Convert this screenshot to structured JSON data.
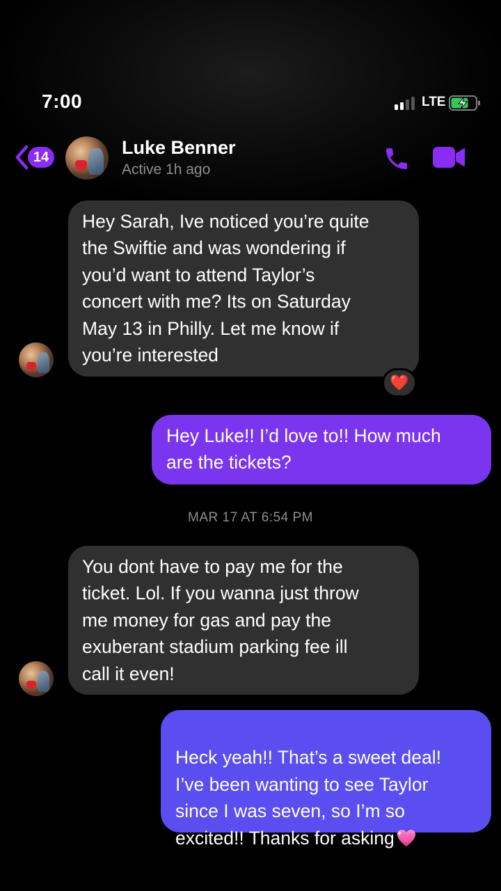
{
  "status_bar": {
    "time": "7:00",
    "network": "LTE"
  },
  "header": {
    "back_badge": "14",
    "contact_name": "Luke Benner",
    "contact_status": "Active 1h ago"
  },
  "icons": {
    "back": "chevron-left-icon",
    "call": "phone-icon",
    "video": "video-camera-icon",
    "reaction": "red-heart-emoji",
    "sparkle_heart": "sparkling-heart-emoji"
  },
  "colors": {
    "accent": "#8b2cf5",
    "outgoing_1": "#7b35ef",
    "outgoing_2": "#5a4ef0",
    "incoming": "#303030",
    "background": "#000000"
  },
  "messages": [
    {
      "sender": "Luke Benner",
      "direction": "incoming",
      "text": "Hey Sarah, Ive noticed you’re quite\nthe Swiftie and was wondering if\nyou’d want to attend Taylor’s\nconcert with me?  Its on Saturday\nMay 13 in Philly.  Let me know if\nyou’re interested",
      "reaction": "❤️"
    },
    {
      "sender": "me",
      "direction": "outgoing",
      "text": "Hey Luke!! I’d love to!! How much\nare the tickets?"
    },
    {
      "timestamp": "MAR 17 AT 6:54 PM"
    },
    {
      "sender": "Luke Benner",
      "direction": "incoming",
      "text": "You dont have to pay me for the\nticket. Lol.  If you wanna just throw\nme money for gas and pay the\nexuberant stadium parking fee ill\ncall it even!"
    },
    {
      "sender": "me",
      "direction": "outgoing",
      "text": "Heck yeah!! That’s a sweet deal!\nI’ve been wanting to see Taylor\nsince I was seven, so I’m so\nexcited!! Thanks for asking",
      "trailing_emoji": "💗"
    }
  ]
}
